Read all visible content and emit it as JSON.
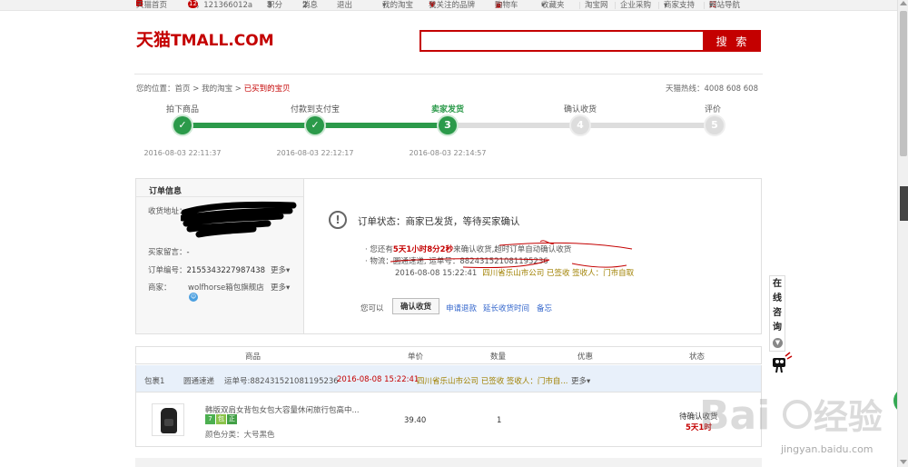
{
  "topbar": {
    "home": "天猫首页",
    "greeting": "Hi，121366012a",
    "greeting_badge": "12",
    "points_label": "积分",
    "points": "3",
    "messages_label": "消息",
    "messages": "2",
    "logout": "退出",
    "my_taobao": "我的淘宝",
    "followed_brands": "我关注的品牌",
    "cart": "购物车",
    "favorites": "收藏夹",
    "taobao": "淘宝网",
    "enterprise": "企业采购",
    "merchant_support": "商家支持",
    "site_nav": "网站导航"
  },
  "header": {
    "logo_cn": "天猫",
    "logo_en": "TMALL.COM",
    "search_placeholder": "",
    "search_button": "搜 索"
  },
  "breadcrumb": {
    "prefix": "您的位置：",
    "items": [
      "首页",
      "我的淘宝",
      "已买到的宝贝"
    ],
    "sep": " > "
  },
  "hotline": "天猫热线：4008 608 608",
  "steps": [
    {
      "label": "拍下商品",
      "number": "1",
      "state": "done",
      "time": "2016-08-03 22:11:37"
    },
    {
      "label": "付款到支付宝",
      "number": "2",
      "state": "done",
      "time": "2016-08-03 22:12:17"
    },
    {
      "label": "卖家发货",
      "number": "3",
      "state": "active",
      "time": "2016-08-03 22:14:57"
    },
    {
      "label": "确认收货",
      "number": "4",
      "state": "todo",
      "time": ""
    },
    {
      "label": "评价",
      "number": "5",
      "state": "todo",
      "time": ""
    }
  ],
  "order_info": {
    "title": "订单信息",
    "address_label": "收货地址：",
    "buyer_msg_label": "买家留言：",
    "buyer_msg": "-",
    "order_no_label": "订单编号：",
    "order_no": "2155343227987438",
    "more": "更多",
    "shop_label": "商家：",
    "shop_name": "wolfhorse箱包旗舰店"
  },
  "status": {
    "title": "订单状态：商家已发货，等待买家确认",
    "notice_prefix": "· 您还有",
    "countdown": "5天1小时8分2秒",
    "notice_suffix": "来确认收货,超时订单自动确认收货",
    "logistics_label": "· 物流：",
    "carrier": "圆通速递",
    "waybill_label": "运单号：",
    "waybill": "882431521081195236",
    "track_time": "2016-08-08 15:22:41",
    "track_dest": "四川省乐山市公司 已签收 签收人：门市自取",
    "can_label": "您可以",
    "confirm_button": "确认收货",
    "refund": "申请退款",
    "extend": "延长收货时间",
    "note": "备忘"
  },
  "table": {
    "headers": [
      "商品",
      "单价",
      "数量",
      "优惠",
      "状态"
    ],
    "package": {
      "name": "包裹1",
      "carrier": "圆通速递",
      "waybill": "运单号:882431521081195236",
      "time": "2016-08-08 15:22:41",
      "dest": "四川省乐山市公司 已签收 签收人：门市自...",
      "more": "更多"
    },
    "item": {
      "title": "韩版双肩女背包女包大容量休闲旅行包高中...",
      "tags": [
        "7",
        "包",
        "正"
      ],
      "sku": "颜色分类：大号黑色",
      "price": "39.40",
      "qty": "1",
      "status": "待确认收货",
      "countdown": "5天1时"
    }
  },
  "side": {
    "consult": [
      "在",
      "线",
      "咨",
      "询"
    ]
  },
  "watermark": "jingyan.baidu.com",
  "colors": {
    "brand": "#c40000",
    "step_done": "#2b9a4a",
    "link": "#3366cc",
    "package_row": "#e8f0fa"
  }
}
